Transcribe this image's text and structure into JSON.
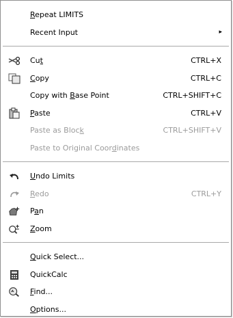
{
  "menu": {
    "items": [
      {
        "id": "repeat-limits",
        "pre": "",
        "u": "R",
        "post": "epeat LIMITS",
        "shortcut": "",
        "icon": ""
      },
      {
        "id": "recent-input",
        "pre": "Recent Input",
        "u": "",
        "post": "",
        "shortcut": "",
        "icon": "",
        "submenu": "▸"
      },
      {
        "sep": true
      },
      {
        "id": "cut",
        "pre": "Cu",
        "u": "t",
        "post": "",
        "shortcut": "CTRL+X",
        "icon": "scissors-icon"
      },
      {
        "id": "copy",
        "pre": "",
        "u": "C",
        "post": "opy",
        "shortcut": "CTRL+C",
        "icon": "copy-icon"
      },
      {
        "id": "copy-with-base-point",
        "pre": "Copy with ",
        "u": "B",
        "post": "ase Point",
        "shortcut": "CTRL+SHIFT+C",
        "icon": ""
      },
      {
        "id": "paste",
        "pre": "",
        "u": "P",
        "post": "aste",
        "shortcut": "CTRL+V",
        "icon": "paste-icon"
      },
      {
        "id": "paste-as-block",
        "pre": "Paste as Bloc",
        "u": "k",
        "post": "",
        "shortcut": "CTRL+SHIFT+V",
        "icon": "",
        "disabled": true
      },
      {
        "id": "paste-to-original",
        "pre": "Paste to Original Coor",
        "u": "d",
        "post": "inates",
        "shortcut": "",
        "icon": "",
        "disabled": true
      },
      {
        "sep": true
      },
      {
        "id": "undo-limits",
        "pre": "",
        "u": "U",
        "post": "ndo Limits",
        "shortcut": "",
        "icon": "undo-icon"
      },
      {
        "id": "redo",
        "pre": "",
        "u": "R",
        "post": "edo",
        "shortcut": "CTRL+Y",
        "icon": "redo-icon",
        "disabled": true
      },
      {
        "id": "pan",
        "pre": "P",
        "u": "a",
        "post": "n",
        "shortcut": "",
        "icon": "pan-icon"
      },
      {
        "id": "zoom",
        "pre": "",
        "u": "Z",
        "post": "oom",
        "shortcut": "",
        "icon": "zoom-icon"
      },
      {
        "sep": true
      },
      {
        "id": "quick-select",
        "pre": "",
        "u": "Q",
        "post": "uick Select...",
        "shortcut": "",
        "icon": ""
      },
      {
        "id": "quickcalc",
        "pre": "QuickCalc",
        "u": "",
        "post": "",
        "shortcut": "",
        "icon": "calculator-icon"
      },
      {
        "id": "find",
        "pre": "",
        "u": "F",
        "post": "ind...",
        "shortcut": "",
        "icon": "find-icon"
      },
      {
        "id": "options",
        "pre": "",
        "u": "O",
        "post": "ptions...",
        "shortcut": "",
        "icon": ""
      }
    ]
  }
}
